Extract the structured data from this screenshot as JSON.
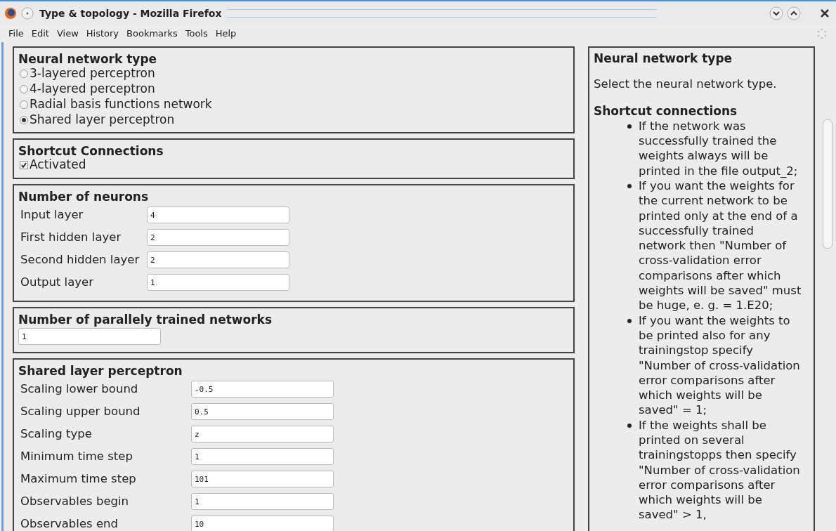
{
  "window": {
    "title": "Type & topology - Mozilla Firefox"
  },
  "menu": [
    {
      "label": "File"
    },
    {
      "label": "Edit"
    },
    {
      "label": "View"
    },
    {
      "label": "History"
    },
    {
      "label": "Bookmarks"
    },
    {
      "label": "Tools"
    },
    {
      "label": "Help"
    }
  ],
  "network_type": {
    "title": "Neural network type",
    "options": [
      {
        "label": "3-layered perceptron",
        "selected": false
      },
      {
        "label": "4-layered perceptron",
        "selected": false
      },
      {
        "label": "Radial basis functions network",
        "selected": false
      },
      {
        "label": "Shared layer perceptron",
        "selected": true
      }
    ]
  },
  "shortcut": {
    "title": "Shortcut Connections",
    "label": "Activated",
    "checked": true
  },
  "neurons": {
    "title": "Number of neurons",
    "fields": [
      {
        "label": "Input layer",
        "value": "4"
      },
      {
        "label": "First hidden layer",
        "value": "2"
      },
      {
        "label": "Second hidden layer",
        "value": "2"
      },
      {
        "label": "Output layer",
        "value": "1"
      }
    ]
  },
  "parallel": {
    "title": "Number of parallely trained networks",
    "value": "1"
  },
  "shared": {
    "title": "Shared layer perceptron",
    "fields": [
      {
        "label": "Scaling lower bound",
        "value": "-0.5"
      },
      {
        "label": "Scaling upper bound",
        "value": "0.5"
      },
      {
        "label": "Scaling type",
        "value": "z"
      },
      {
        "label": "Minimum time step",
        "value": "1"
      },
      {
        "label": "Maximum time step",
        "value": "101"
      },
      {
        "label": "Observables begin",
        "value": "1"
      },
      {
        "label": "Observables end",
        "value": "10"
      }
    ]
  },
  "help": {
    "title": "Neural network type",
    "text": "Select the neural network type.",
    "subtitle": "Shortcut connections",
    "bullets": [
      "If the network was successfully trained the weights always will be printed in the file output_2;",
      "If you want the weights for the current network to be printed only at the end of a successfully trained network then \"Number of cross-validation error comparisons after which weights will be saved\" must be huge, e. g. = 1.E20;",
      "If you want the weights to be printed also for any trainingstop specify \"Number of cross-validation error comparisons after which weights will be saved\" = 1;",
      "If the weights shall be printed on several trainingstopps then specify \"Number of cross-validation error comparisons after which weights will be saved\" > 1,"
    ]
  }
}
